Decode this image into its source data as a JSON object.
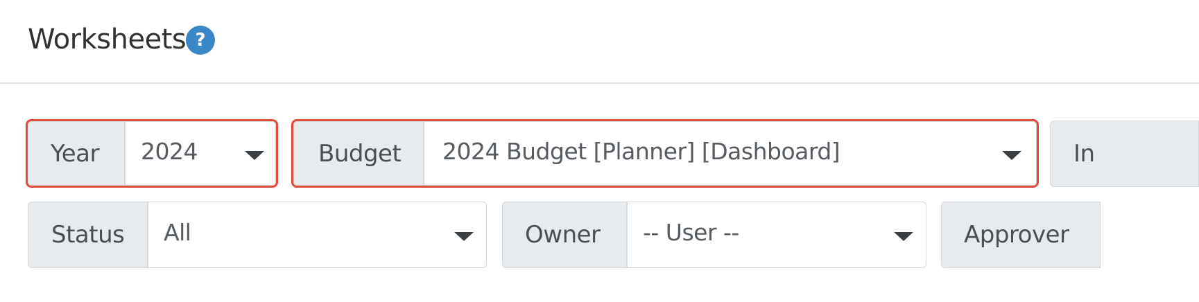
{
  "header": {
    "title": "Worksheets",
    "help_symbol": "?"
  },
  "filters": {
    "year": {
      "label": "Year",
      "value": "2024"
    },
    "budget": {
      "label": "Budget",
      "value": "2024 Budget [Planner] [Dashboard]"
    },
    "third_label_partial": "In",
    "status": {
      "label": "Status",
      "value": "All"
    },
    "owner": {
      "label": "Owner",
      "value": "-- User --"
    },
    "approver": {
      "label": "Approver"
    }
  },
  "colors": {
    "highlight": "#e04b3a",
    "help_badge": "#3a87c8",
    "label_bg": "#e8ebee"
  },
  "icons": [
    "help-icon",
    "chevron-down-icon"
  ]
}
